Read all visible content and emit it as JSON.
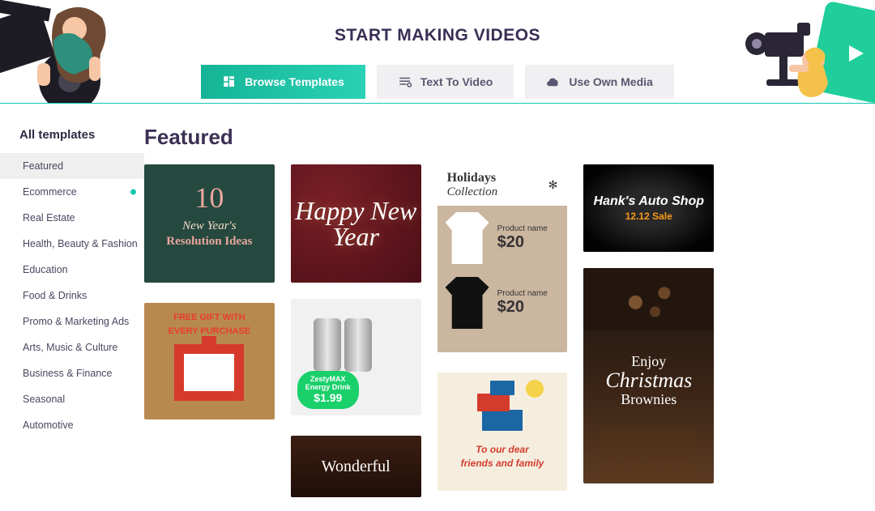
{
  "hero": {
    "title": "START MAKING VIDEOS"
  },
  "modes": {
    "browse": "Browse Templates",
    "textToVideo": "Text To Video",
    "ownMedia": "Use Own Media"
  },
  "sidebar": {
    "title": "All templates",
    "categories": [
      "Featured",
      "Ecommerce",
      "Real Estate",
      "Health, Beauty & Fashion",
      "Education",
      "Food & Drinks",
      "Promo & Marketing Ads",
      "Arts, Music & Culture",
      "Business & Finance",
      "Seasonal",
      "Automotive"
    ]
  },
  "section": {
    "title": "Featured"
  },
  "cards": {
    "resolutions": {
      "number": "10",
      "line1": "New Year's",
      "line2": "Resolution Ideas"
    },
    "gift": {
      "line1": "FREE GIFT WITH",
      "line2": "EVERY PURCHASE"
    },
    "newyear": {
      "text": "Happy New Year"
    },
    "energy": {
      "brand": "ZestyMAX",
      "product": "Energy Drink",
      "price": "$1.99"
    },
    "wonderful": {
      "text": "Wonderful"
    },
    "holidays": {
      "title1": "Holidays",
      "title2": "Collection",
      "flake": "✻",
      "items": [
        {
          "label": "Product name",
          "price": "$20"
        },
        {
          "label": "Product name",
          "price": "$20"
        }
      ]
    },
    "dear": {
      "line1": "To our dear",
      "line2": "friends and family"
    },
    "tire": {
      "name": "Hank's Auto Shop",
      "sale": "12.12 Sale"
    },
    "brownies": {
      "l1": "Enjoy",
      "l2": "Christmas",
      "l3": "Brownies"
    }
  }
}
